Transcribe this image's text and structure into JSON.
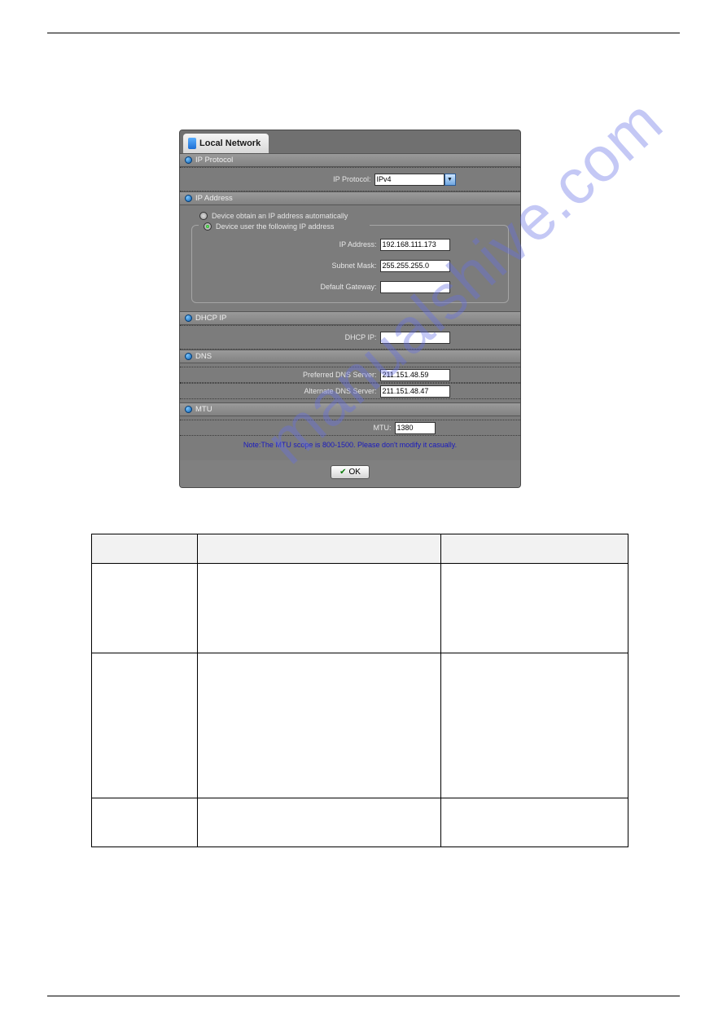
{
  "panel": {
    "tab_label": "Local Network",
    "sections": {
      "ip_protocol": {
        "title": "IP Protocol",
        "label": "IP Protocol:",
        "value": "IPv4"
      },
      "ip_address": {
        "title": "IP Address",
        "radio_auto": "Device obtain an IP address automatically",
        "radio_manual": "Device user the following IP address",
        "ip_label": "IP Address:",
        "ip_value": "192.168.111.173",
        "mask_label": "Subnet Mask:",
        "mask_value": "255.255.255.0",
        "gw_label": "Default Gateway:",
        "gw_value": ""
      },
      "dhcp": {
        "title": "DHCP IP",
        "label": "DHCP IP:",
        "value": ""
      },
      "dns": {
        "title": "DNS",
        "pref_label": "Preferred DNS Server:",
        "pref_value": "211.151.48.59",
        "alt_label": "Alternate DNS Server:",
        "alt_value": "211.151.48.47"
      },
      "mtu": {
        "title": "MTU",
        "label": "MTU:",
        "value": "1380",
        "note": "Note:The MTU scope is 800-1500. Please don't modify it casually."
      }
    },
    "ok_label": "OK"
  },
  "table": {
    "headers": [
      "",
      "",
      ""
    ],
    "rows": [
      [
        "",
        "",
        ""
      ],
      [
        "",
        "",
        ""
      ],
      [
        "",
        "",
        ""
      ]
    ]
  },
  "watermark": "manualshive.com"
}
